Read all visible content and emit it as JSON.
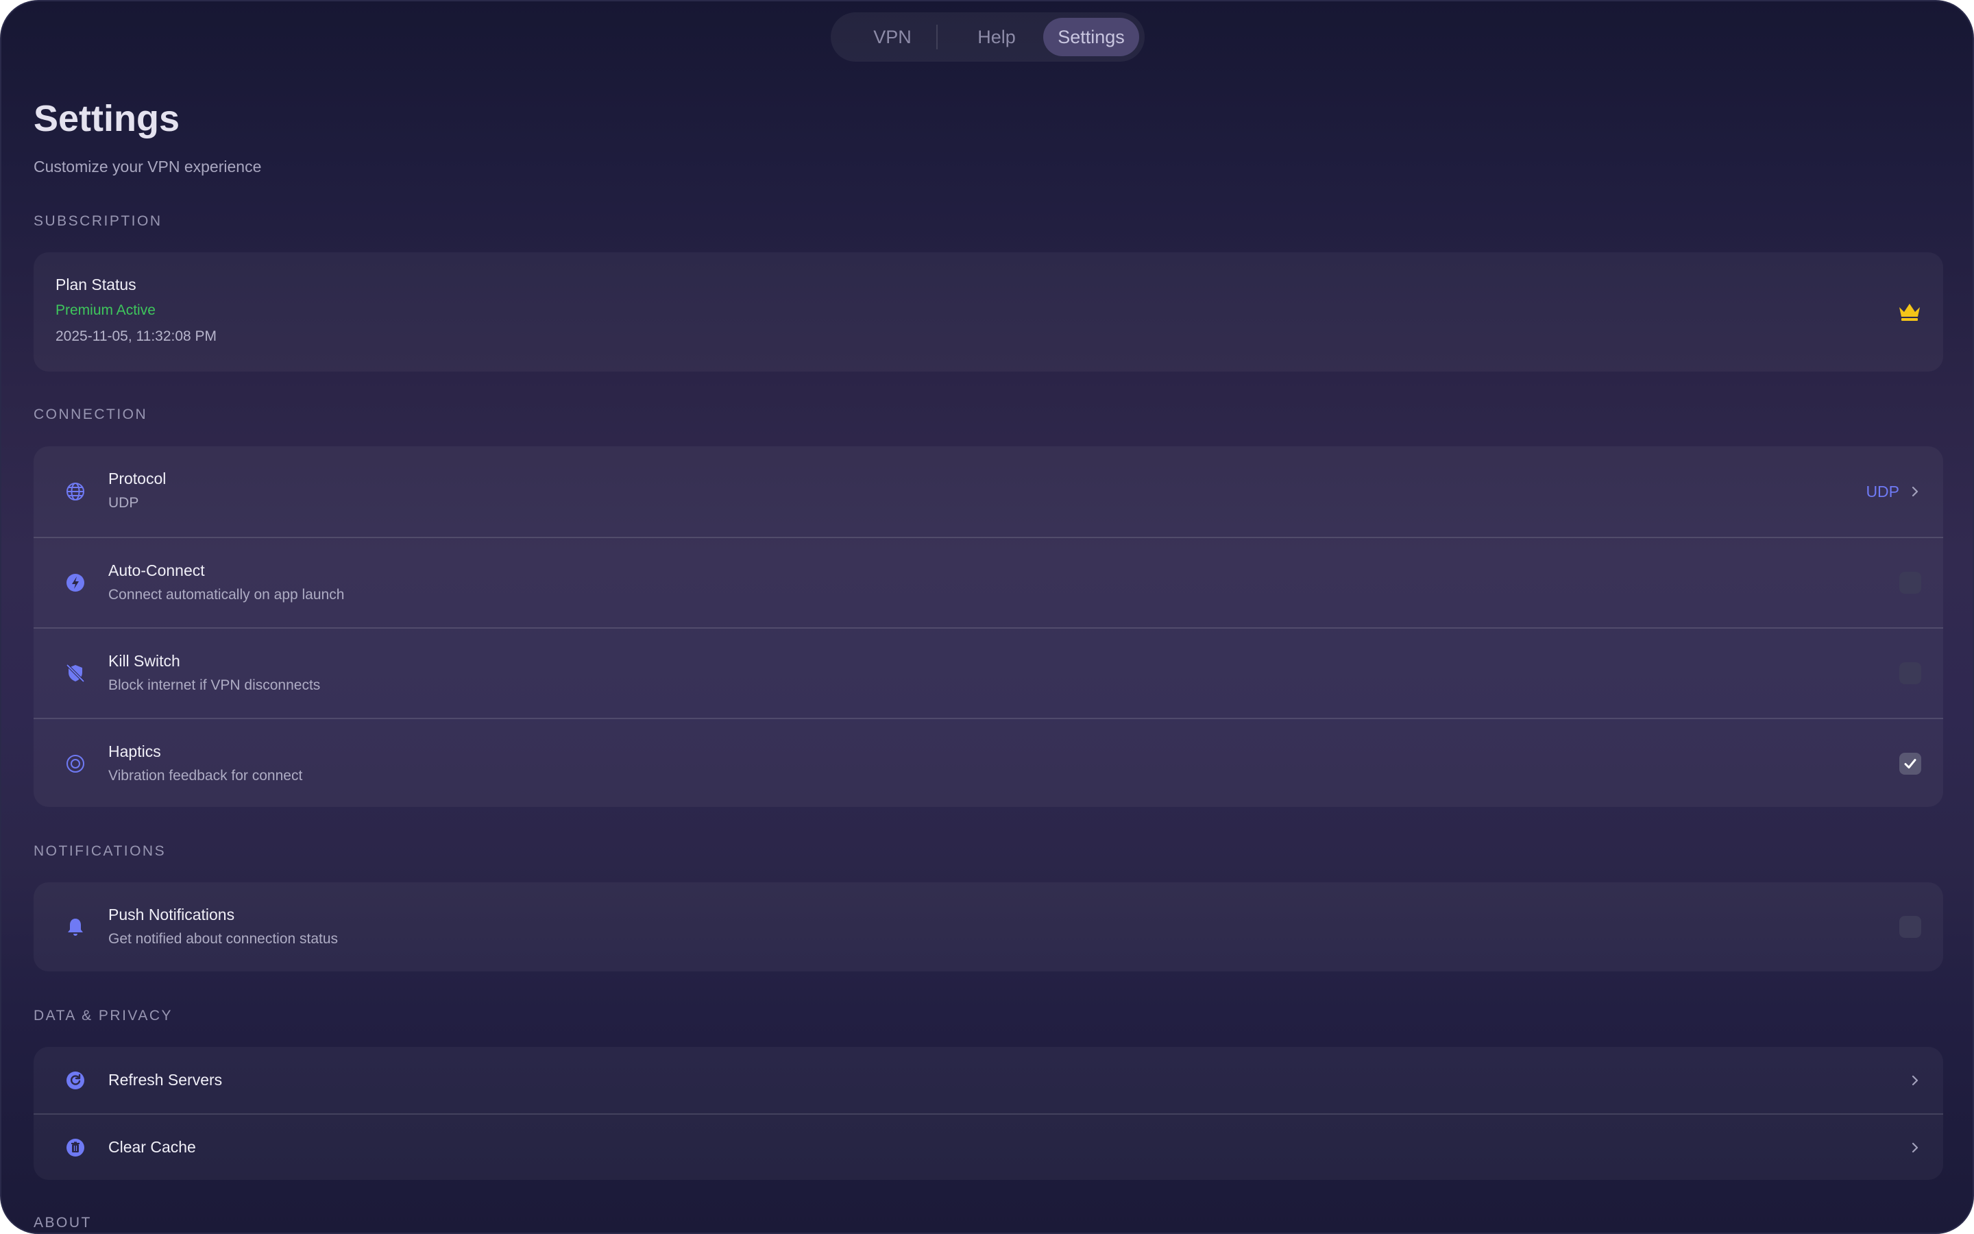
{
  "nav": {
    "tabs": [
      {
        "label": "VPN"
      },
      {
        "label": "Help"
      },
      {
        "label": "Settings",
        "active": true
      }
    ]
  },
  "header": {
    "title": "Settings",
    "subtitle": "Customize your VPN experience"
  },
  "sections": {
    "subscription": {
      "label": "SUBSCRIPTION",
      "plan_title": "Plan Status",
      "plan_status": "Premium Active",
      "plan_date": "2025-11-05, 11:32:08 PM",
      "icon": "crown-icon"
    },
    "connection": {
      "label": "CONNECTION",
      "protocol": {
        "title": "Protocol",
        "subtitle": "UDP",
        "value": "UDP",
        "icon": "globe-icon"
      },
      "auto_connect": {
        "title": "Auto-Connect",
        "subtitle": "Connect automatically on app launch",
        "checked": false,
        "icon": "bolt-icon"
      },
      "kill_switch": {
        "title": "Kill Switch",
        "subtitle": "Block internet if VPN disconnects",
        "checked": false,
        "icon": "shield-off-icon"
      },
      "haptics": {
        "title": "Haptics",
        "subtitle": "Vibration feedback for connect",
        "checked": true,
        "icon": "vibration-icon"
      }
    },
    "notifications": {
      "label": "NOTIFICATIONS",
      "push": {
        "title": "Push Notifications",
        "subtitle": "Get notified about connection status",
        "checked": false,
        "icon": "bell-icon"
      }
    },
    "data_privacy": {
      "label": "DATA & PRIVACY",
      "refresh": {
        "title": "Refresh Servers",
        "icon": "refresh-icon"
      },
      "clear_cache": {
        "title": "Clear Cache",
        "icon": "trash-icon"
      }
    },
    "about": {
      "label": "ABOUT"
    }
  },
  "colors": {
    "accent": "#6f7af4",
    "success": "#3ec65c",
    "crown": "#f5c518"
  }
}
